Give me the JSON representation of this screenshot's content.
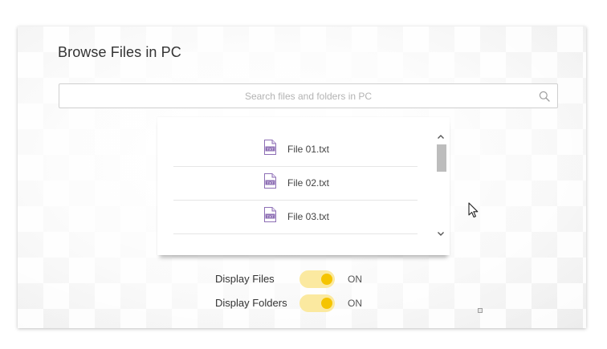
{
  "window": {
    "title": "Browse Files in PC"
  },
  "search": {
    "placeholder": "Search files and folders in PC",
    "value": "",
    "icon": "search-icon"
  },
  "file_list": {
    "items": [
      {
        "label": "File 01.txt",
        "icon": "txt-file-icon",
        "icon_text": "TXT"
      },
      {
        "label": "File 02.txt",
        "icon": "txt-file-icon",
        "icon_text": "TXT"
      },
      {
        "label": "File 03.txt",
        "icon": "txt-file-icon",
        "icon_text": "TXT"
      }
    ],
    "scroll_position": 0.0
  },
  "options": {
    "display_files": {
      "label": "Display Files",
      "state": "ON",
      "on": true
    },
    "display_folders": {
      "label": "Display Folders",
      "state": "ON",
      "on": true
    }
  },
  "colors": {
    "toggle_track": "#fbe9a0",
    "toggle_knob": "#f5c400",
    "file_icon": "#8e6fb5"
  }
}
